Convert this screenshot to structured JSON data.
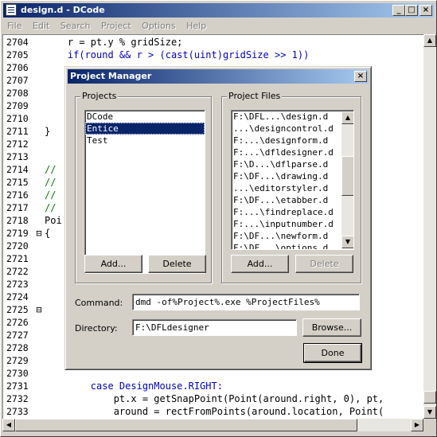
{
  "window": {
    "title": "design.d - DCode"
  },
  "menu": [
    {
      "label": "File"
    },
    {
      "label": "Edit"
    },
    {
      "label": "Search"
    },
    {
      "label": "Project"
    },
    {
      "label": "Options"
    },
    {
      "label": "Help"
    }
  ],
  "code_lines": [
    {
      "num": "2704",
      "fold": "",
      "text": "    r = pt.y % gridSize;"
    },
    {
      "num": "2705",
      "fold": "",
      "text": "    if(round && r > (cast(uint)gridSize >> 1))"
    },
    {
      "num": "2706",
      "fold": "",
      "text": ""
    },
    {
      "num": "2707",
      "fold": "",
      "text": ""
    },
    {
      "num": "2708",
      "fold": "",
      "text": ""
    },
    {
      "num": "2709",
      "fold": "",
      "text": ""
    },
    {
      "num": "2710",
      "fold": "",
      "text": ""
    },
    {
      "num": "2711",
      "fold": "",
      "text": "}"
    },
    {
      "num": "2712",
      "fold": "",
      "text": ""
    },
    {
      "num": "2713",
      "fold": "",
      "text": ""
    },
    {
      "num": "2714",
      "fold": "",
      "text": "//"
    },
    {
      "num": "2715",
      "fold": "",
      "text": "//"
    },
    {
      "num": "2716",
      "fold": "",
      "text": "//"
    },
    {
      "num": "2717",
      "fold": "",
      "text": "//"
    },
    {
      "num": "2718",
      "fold": "",
      "text": "Poi                                     around,"
    },
    {
      "num": "2719",
      "fold": "⊟",
      "text": "{"
    },
    {
      "num": "2720",
      "fold": "",
      "text": "                                        e))"
    },
    {
      "num": "2721",
      "fold": "",
      "text": ""
    },
    {
      "num": "2722",
      "fold": "",
      "text": ""
    },
    {
      "num": "2723",
      "fold": "",
      "text": ""
    },
    {
      "num": "2724",
      "fold": "",
      "text": ""
    },
    {
      "num": "2725",
      "fold": "⊟",
      "text": ""
    },
    {
      "num": "2726",
      "fold": "",
      "text": ""
    },
    {
      "num": "2727",
      "fold": "",
      "text": "                                       round.bo"
    },
    {
      "num": "2728",
      "fold": "",
      "text": "                                      , pt);"
    },
    {
      "num": "2729",
      "fold": "",
      "text": ""
    },
    {
      "num": "2730",
      "fold": "",
      "text": ""
    },
    {
      "num": "2731",
      "fold": "",
      "text": "        case DesignMouse.RIGHT:"
    },
    {
      "num": "2732",
      "fold": "",
      "text": "            pt.x = getSnapPoint(Point(around.right, 0), pt,"
    },
    {
      "num": "2733",
      "fold": "",
      "text": "            around = rectFromPoints(around.location, Point("
    }
  ],
  "dialog": {
    "title": "Project Manager",
    "projects_group": "Projects",
    "projects": [
      "DCode",
      "Entice",
      "Test"
    ],
    "selected_project": "Entice",
    "files_group": "Project Files",
    "files": [
      "F:\\DFL...\\design.d",
      "...\\designcontrol.d",
      "F:...\\designform.d",
      "F:...\\dfldesigner.d",
      "F:\\D...\\dflparse.d",
      "F:\\DF...\\drawing.d",
      "...\\editorstyler.d",
      "F:\\DF...\\etabber.d",
      "F:...\\findreplace.d",
      "F:...\\inputnumber.d",
      "F:\\DF...\\newform.d",
      "F:\\DF...\\options.d"
    ],
    "add_projects": "Add...",
    "delete_projects": "Delete",
    "add_files": "Add...",
    "delete_files": "Delete",
    "command_label": "Command:",
    "command_value": "dmd -of%Project%.exe %ProjectFiles%",
    "directory_label": "Directory:",
    "directory_value": "F:\\DFLdesigner",
    "browse": "Browse...",
    "done": "Done"
  }
}
